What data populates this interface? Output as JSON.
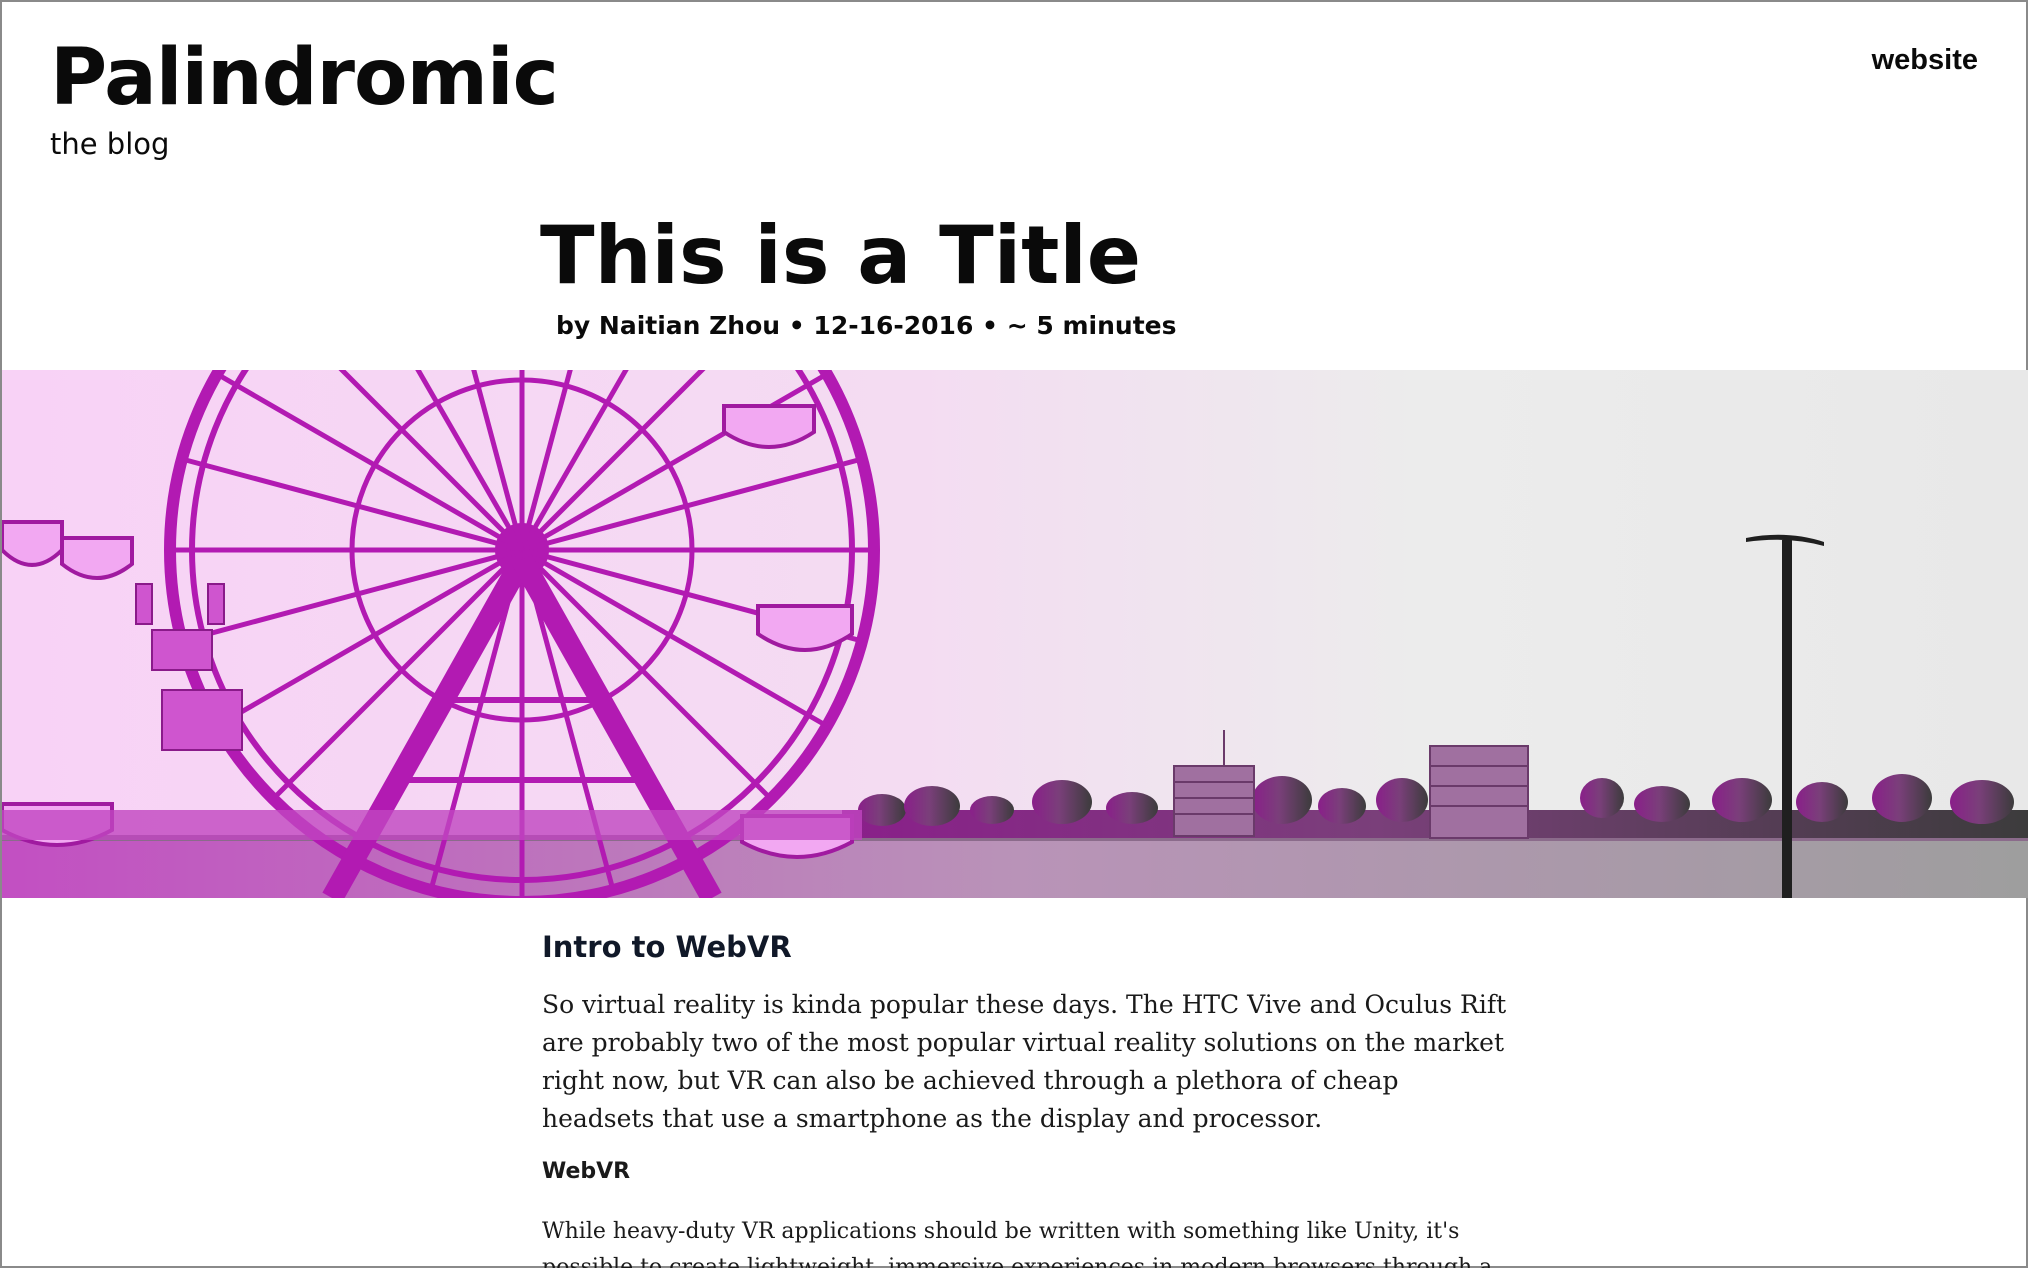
{
  "site": {
    "title": "Palindromic",
    "subtitle": "the blog",
    "nav_link": "website"
  },
  "post": {
    "title": "This is a Title",
    "meta": "by Naitian Zhou • 12-16-2016 • ~ 5 minutes",
    "hero_image": {
      "subject": "ferris wheel by a lake with city skyline",
      "tint_color": "#e020e0",
      "base_color": "#e8e8e8"
    }
  },
  "content": {
    "section_heading": "Intro to WebVR",
    "intro_paragraph": "So virtual reality is kinda popular these days. The HTC Vive and Oculus Rift are probably two of the most popular virtual reality solutions on the market right now, but VR can also be achieved through a plethora of cheap headsets that use a smartphone as the display and processor.",
    "sub_heading": "WebVR",
    "body_paragraph": "While heavy-duty VR applications should be written with something like Unity, it's possible to create lightweight, immersive experiences in modern browsers through a new experimental standard called WebVR."
  }
}
